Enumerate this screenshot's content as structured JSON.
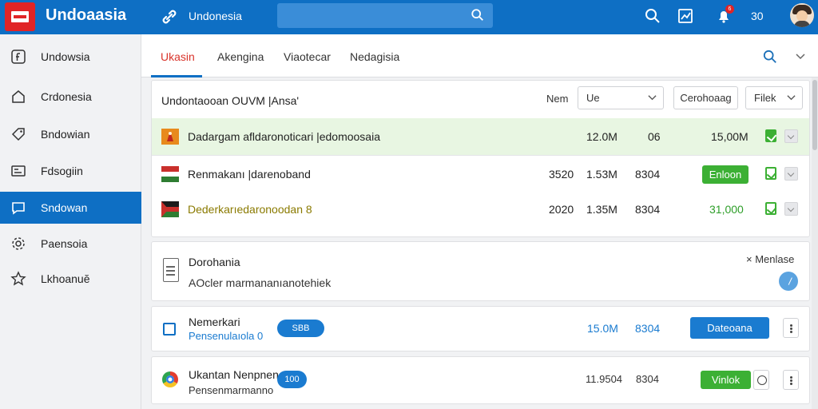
{
  "header": {
    "app_title": "Undoaasia",
    "subtitle": "Undonesia",
    "search_placeholder": "",
    "counter": "30",
    "notification_count": "6"
  },
  "sidebar": {
    "items": [
      {
        "label": "Undowsia",
        "icon": "f-square-icon"
      },
      {
        "label": "Crdonesia",
        "icon": "home-icon"
      },
      {
        "label": "Bndowian",
        "icon": "tag-icon"
      },
      {
        "label": "Fdsogiin",
        "icon": "id-card-icon"
      },
      {
        "label": "Sndowan",
        "icon": "chat-icon",
        "active": true
      },
      {
        "label": "Paensoia",
        "icon": "gear-icon"
      },
      {
        "label": "Lkhoanuĕ",
        "icon": "star-icon"
      }
    ]
  },
  "tabs": [
    {
      "label": "Ukasin",
      "active": true
    },
    {
      "label": "Akengina"
    },
    {
      "label": "Viaotecar"
    },
    {
      "label": "Nedagisia"
    }
  ],
  "table_card": {
    "title": "Undontaooan OUVM |Ansa'",
    "sort_label": "Nem",
    "dropdown_value": "Ue",
    "button_label": "Cerohoaag",
    "filter_label": "Filek",
    "rows": [
      {
        "name": "Dadargam afldaronoticari |edomoosaia",
        "c2": "",
        "c3": "12.0M",
        "c4": "06",
        "c5": "15,00M",
        "pill": "",
        "highlight": true,
        "checkbox": "filled"
      },
      {
        "name": "Renmakanı |darenoband",
        "c2": "3520",
        "c3": "1.53M",
        "c4": "8304",
        "c5": "",
        "pill": "Enloon",
        "highlight": false,
        "checkbox": "outline"
      },
      {
        "name": "Dederkarıedaronoodan 8",
        "c2": "2020",
        "c3": "1.35M",
        "c4": "8304",
        "c5": "31,000",
        "pill": "",
        "highlight": false,
        "checkbox": "outline",
        "olive": true
      }
    ]
  },
  "doc_card": {
    "title": "Dorohania",
    "description": "AOcler marmananıanotehiek",
    "more_label": "Menlase"
  },
  "item_card_1": {
    "title": "Nemerkari",
    "subtitle": "Pensenulaıola 0",
    "pill": "SBB",
    "value1": "15.0M",
    "value2": "8304",
    "button": "Dateoana"
  },
  "item_card_2": {
    "title": "Ukantan Nenpnen",
    "subtitle": "Pensenmarmanno",
    "pill": "100",
    "value1": "11.9504",
    "value2": "8304",
    "button": "Vinlok"
  },
  "colors": {
    "brand_blue": "#0e6fc4",
    "accent_red": "#e02426",
    "success_green": "#3cb034"
  }
}
